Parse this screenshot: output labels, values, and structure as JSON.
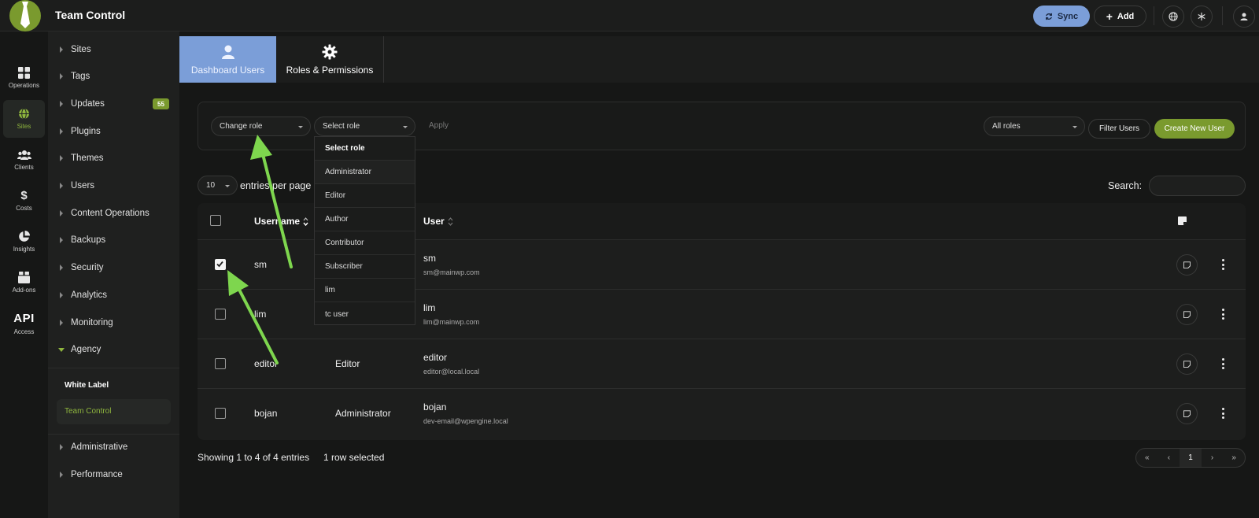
{
  "app": {
    "title": "Team Control"
  },
  "topbar": {
    "sync_label": "Sync",
    "add_label": "Add",
    "accent": "#7b9ed8",
    "brand": "#7a9a2e"
  },
  "rail": [
    {
      "label": "Operations",
      "icon": "grid-icon"
    },
    {
      "label": "Sites",
      "icon": "globe-icon",
      "active": true
    },
    {
      "label": "Clients",
      "icon": "users-icon"
    },
    {
      "label": "Costs",
      "icon": "dollar-icon"
    },
    {
      "label": "Insights",
      "icon": "pie-icon"
    },
    {
      "label": "Add-ons",
      "icon": "box-icon"
    },
    {
      "label": "Access",
      "icon": "api-icon",
      "big": "API"
    }
  ],
  "nav": {
    "items": [
      {
        "label": "Sites"
      },
      {
        "label": "Tags"
      },
      {
        "label": "Updates",
        "badge": "55"
      },
      {
        "label": "Plugins"
      },
      {
        "label": "Themes"
      },
      {
        "label": "Users"
      },
      {
        "label": "Content Operations"
      },
      {
        "label": "Backups"
      },
      {
        "label": "Security"
      },
      {
        "label": "Analytics"
      },
      {
        "label": "Monitoring"
      },
      {
        "label": "Agency",
        "expanded": true
      }
    ],
    "sub_heading": "White Label",
    "sub_active": "Team Control",
    "bottom_items": [
      {
        "label": "Administrative"
      },
      {
        "label": "Performance"
      }
    ]
  },
  "tabs": [
    {
      "label": "Dashboard Users",
      "active": true
    },
    {
      "label": "Roles & Permissions"
    }
  ],
  "filters": {
    "bulk_action": "Change role",
    "role_select": "Select role",
    "apply_label": "Apply",
    "role_filter": "All roles",
    "filter_button": "Filter Users",
    "create_button": "Create New User"
  },
  "dropdown": {
    "options": [
      "Select role",
      "Administrator",
      "Editor",
      "Author",
      "Contributor",
      "Subscriber",
      "lim",
      "tc user"
    ]
  },
  "table_controls": {
    "page_size": "10",
    "entries_label": "entries per page",
    "search_label": "Search:",
    "search_value": ""
  },
  "table": {
    "headers": {
      "username": "Username",
      "user": "User"
    },
    "rows": [
      {
        "username": "sm",
        "role": "",
        "name": "sm",
        "email": "sm@mainwp.com",
        "checked": true
      },
      {
        "username": "lim",
        "role": "",
        "name": "lim",
        "email": "lim@mainwp.com",
        "checked": false
      },
      {
        "username": "editor",
        "role": "Editor",
        "name": "editor",
        "email": "editor@local.local",
        "checked": false
      },
      {
        "username": "bojan",
        "role": "Administrator",
        "name": "bojan",
        "email": "dev-email@wpengine.local",
        "checked": false
      }
    ]
  },
  "footer": {
    "info": "Showing 1 to 4 of 4 entries",
    "selected": "1 row selected",
    "pager": [
      "«",
      "‹",
      "1",
      "›",
      "»"
    ]
  }
}
